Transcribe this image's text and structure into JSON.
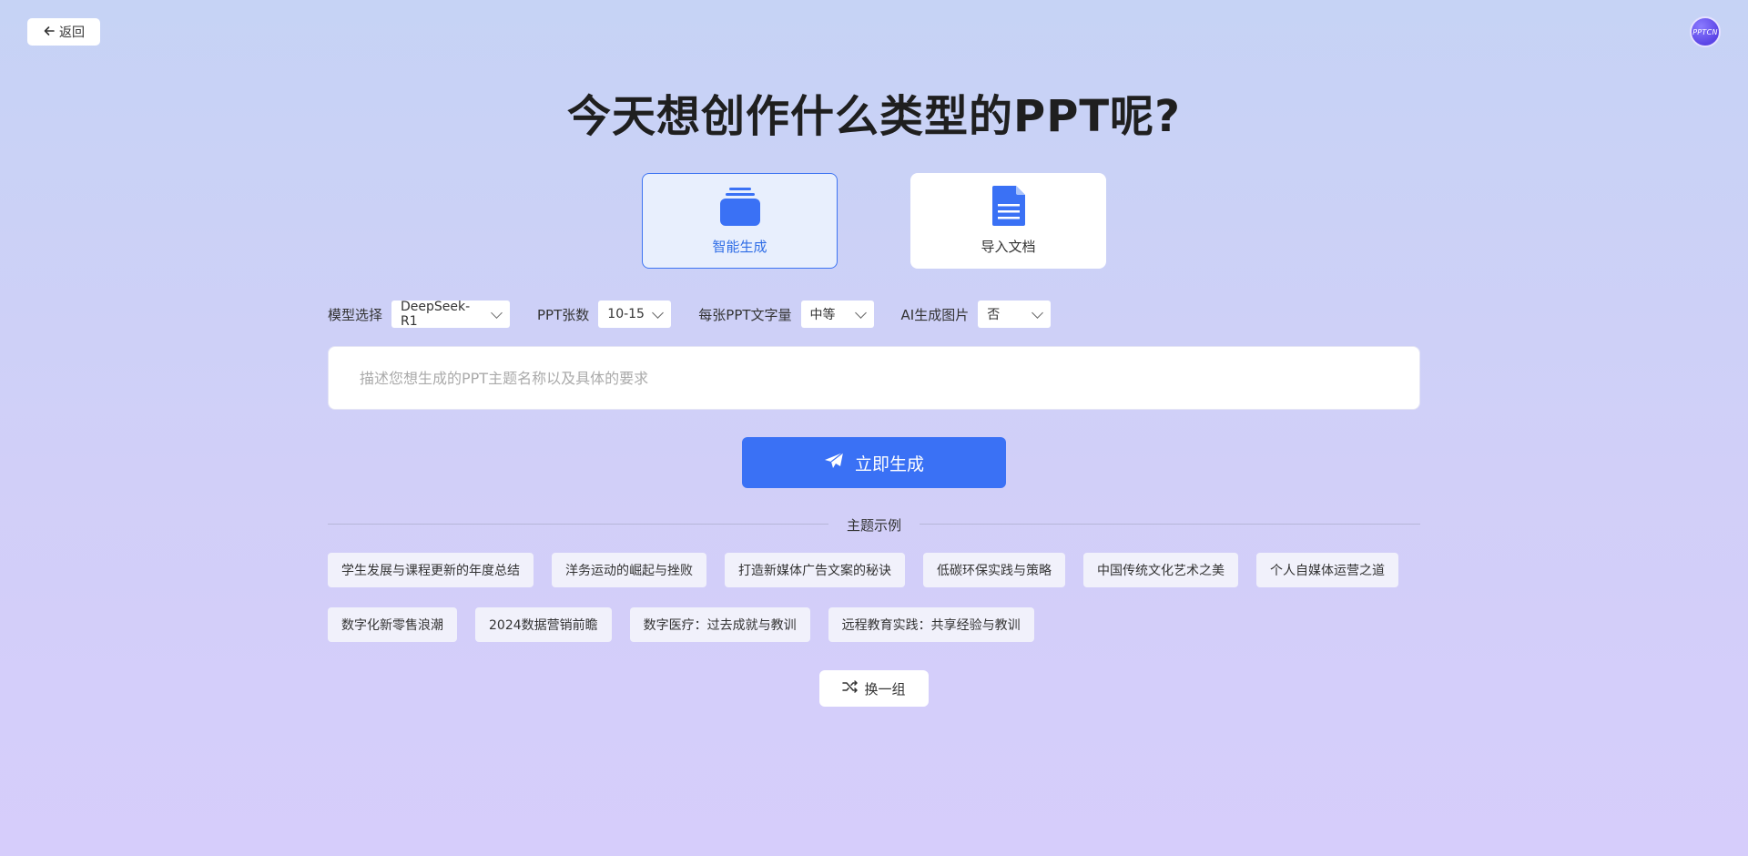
{
  "header": {
    "back_label": "返回",
    "avatar_text": "PPTCN"
  },
  "title": "今天想创作什么类型的PPT呢?",
  "modes": [
    {
      "label": "智能生成",
      "active": true,
      "icon": "stack-icon"
    },
    {
      "label": "导入文档",
      "active": false,
      "icon": "document-icon"
    }
  ],
  "filters": {
    "model": {
      "label": "模型选择",
      "value": "DeepSeek-R1"
    },
    "pages": {
      "label": "PPT张数",
      "value": "10-15"
    },
    "text_amount": {
      "label": "每张PPT文字量",
      "value": "中等"
    },
    "ai_image": {
      "label": "AI生成图片",
      "value": "否"
    }
  },
  "prompt": {
    "placeholder": "描述您想生成的PPT主题名称以及具体的要求",
    "value": ""
  },
  "generate_label": "立即生成",
  "examples": {
    "heading": "主题示例",
    "items": [
      "学生发展与课程更新的年度总结",
      "洋务运动的崛起与挫败",
      "打造新媒体广告文案的秘诀",
      "低碳环保实践与策略",
      "中国传统文化艺术之美",
      "个人自媒体运营之道",
      "数字化新零售浪潮",
      "2024数据营销前瞻",
      "数字医疗：过去成就与教训",
      "远程教育实践：共享经验与教训"
    ],
    "shuffle_label": "换一组"
  },
  "colors": {
    "accent": "#3a71f5",
    "bg_top": "#c6d3f5",
    "bg_bottom": "#d6cdfb"
  }
}
